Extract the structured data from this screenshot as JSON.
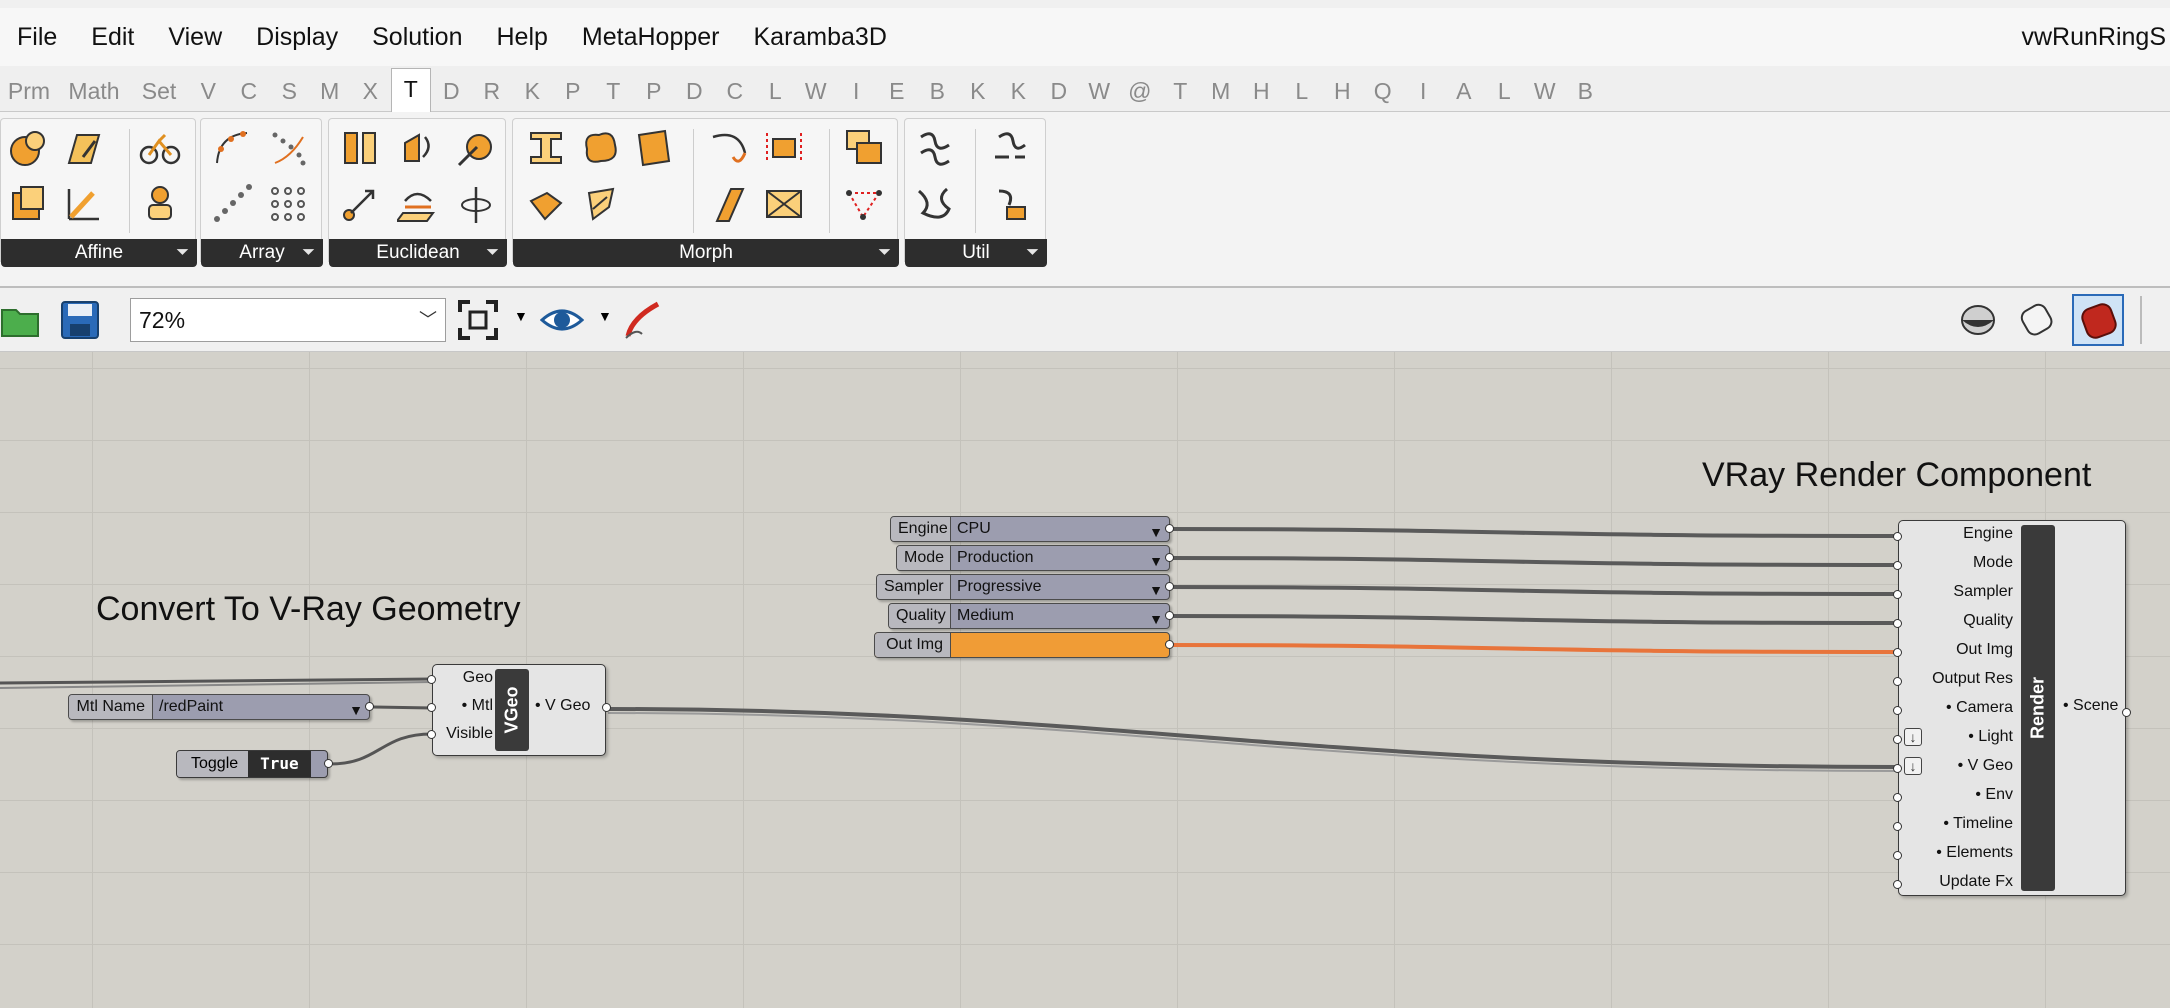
{
  "menu": {
    "items": [
      "File",
      "Edit",
      "View",
      "Display",
      "Solution",
      "Help",
      "MetaHopper",
      "Karamba3D"
    ],
    "document_title": "vwRunRingS"
  },
  "tabs": [
    "Prm",
    "Math",
    "Set",
    "V",
    "C",
    "S",
    "M",
    "X",
    "T",
    "D",
    "R",
    "K",
    "P",
    "T",
    "P",
    "D",
    "C",
    "L",
    "W",
    "I",
    "E",
    "B",
    "K",
    "K",
    "D",
    "W",
    "@",
    "T",
    "M",
    "H",
    "L",
    "H",
    "Q",
    "I",
    "A",
    "L",
    "W",
    "B"
  ],
  "active_tab": "T",
  "ribbon": {
    "groups": [
      "Affine",
      "Array",
      "Euclidean",
      "Morph",
      "Util"
    ]
  },
  "toolbar": {
    "zoom": "72%"
  },
  "canvas": {
    "group_titles": {
      "convert": "Convert To V-Ray Geometry",
      "render": "VRay Render Component"
    },
    "value_lists": [
      {
        "label": "Engine",
        "value": "CPU"
      },
      {
        "label": "Mode",
        "value": "Production"
      },
      {
        "label": "Sampler",
        "value": "Progressive"
      },
      {
        "label": "Quality",
        "value": "Medium"
      },
      {
        "label": "Out Img",
        "value": ""
      }
    ],
    "mtl_list": {
      "label": "Mtl Name",
      "value": "/redPaint"
    },
    "toggle": {
      "label": "Toggle",
      "value": "True"
    },
    "vgeo": {
      "inputs": [
        "Geo",
        "• Mtl",
        "Visible"
      ],
      "core": "VGeo",
      "output": "• V Geo"
    },
    "render": {
      "inputs": [
        "Engine",
        "Mode",
        "Sampler",
        "Quality",
        "Out Img",
        "Output Res",
        "• Camera",
        "• Light",
        "• V Geo",
        "• Env",
        "• Timeline",
        "• Elements",
        "Update Fx"
      ],
      "core": "Render",
      "output": "• Scene"
    },
    "colors": {
      "wire": "#5a5a5a",
      "wire_active": "#e8743b",
      "panel": "#f09c36"
    }
  }
}
